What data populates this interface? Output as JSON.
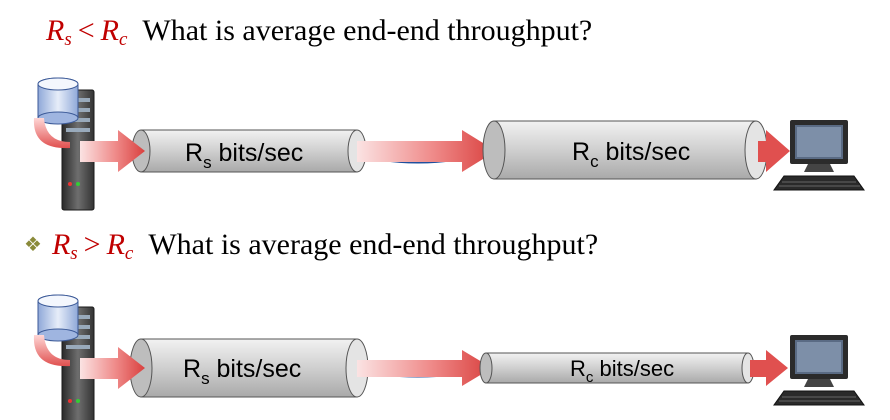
{
  "scenario1": {
    "var_left": "R",
    "sub_left": "s",
    "operator": "<",
    "var_right": "R",
    "sub_right": "c",
    "question": "What is average end-end throughput?",
    "server_pipe": {
      "label_main": "R",
      "label_sub": "s",
      "label_unit": " bits/sec"
    },
    "client_pipe": {
      "label_main": "R",
      "label_sub": "c",
      "label_unit": " bits/sec"
    }
  },
  "scenario2": {
    "bullet": "❖",
    "var_left": "R",
    "sub_left": "s",
    "operator": ">",
    "var_right": "R",
    "sub_right": "c",
    "question": "What is average end-end throughput?",
    "server_pipe": {
      "label_main": "R",
      "label_sub": "s",
      "label_unit": " bits/sec"
    },
    "client_pipe": {
      "label_main": "R",
      "label_sub": "c",
      "label_unit": " bits/sec"
    }
  },
  "colors": {
    "rate_text": "#c00000",
    "arrow": "#e0504f",
    "pipe": "#d9d9d9",
    "router": "#3d73c6"
  }
}
